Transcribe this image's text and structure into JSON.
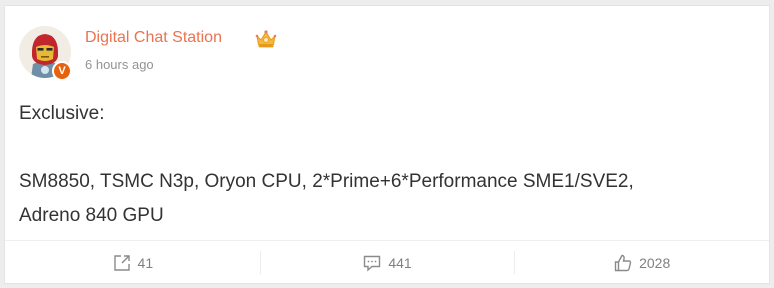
{
  "post": {
    "author": "Digital Chat Station",
    "author_badge": "crown-icon",
    "verified_badge": "V",
    "timestamp": "6 hours ago",
    "content": [
      "Exclusive:",
      "SM8850, TSMC N3p, Oryon CPU, 2*Prime+6*Performance SME1/SVE2,",
      "Adreno 840 GPU"
    ]
  },
  "actions": {
    "share": {
      "icon": "share-icon",
      "count": "41"
    },
    "comment": {
      "icon": "comment-icon",
      "count": "441"
    },
    "like": {
      "icon": "thumbs-up-icon",
      "count": "2028"
    }
  },
  "colors": {
    "author": "#eb7350",
    "verified": "#e8620c",
    "text": "#333333",
    "muted": "#939393",
    "action": "#808080"
  }
}
